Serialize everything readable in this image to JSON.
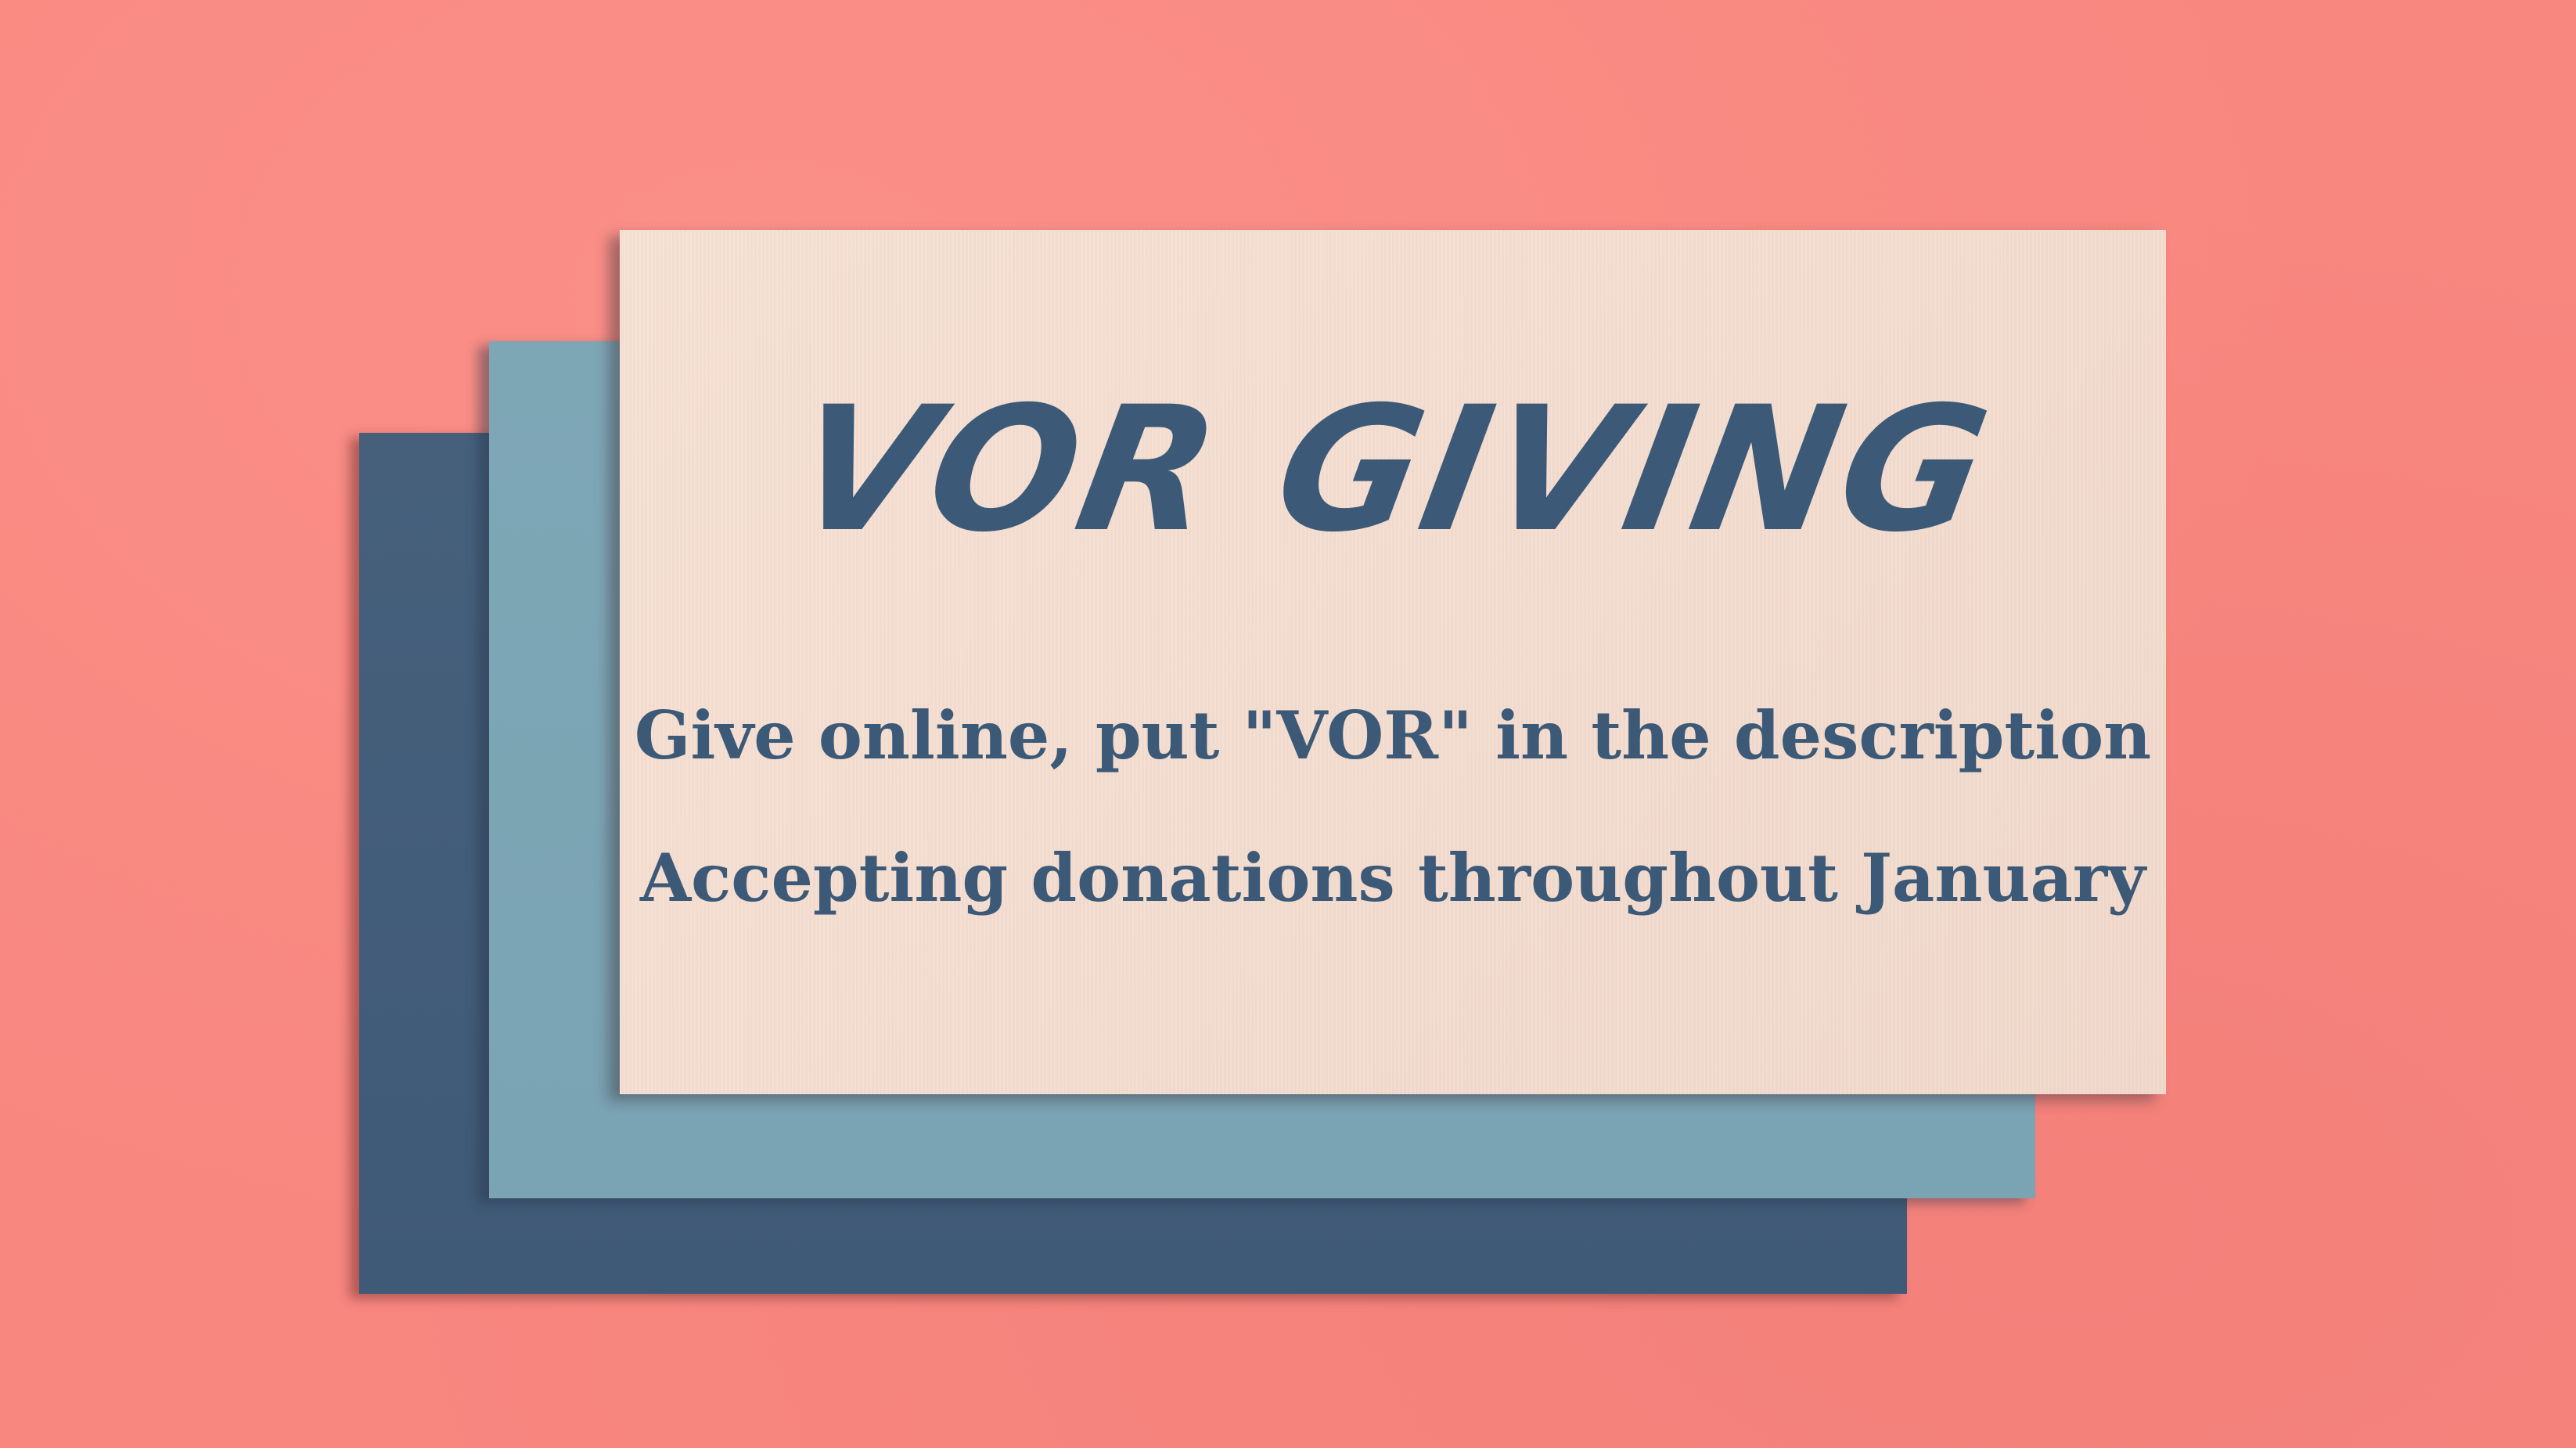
{
  "title": "VOR GIVING",
  "lines": [
    "Give online, put \"VOR\" in the description",
    "Accepting donations throughout January"
  ],
  "colors": {
    "background": "#f88780",
    "sheet_navy": "#43607c",
    "sheet_blue": "#7ea7b6",
    "sheet_cream": "#f6dfd2",
    "text": "#3c5a77"
  }
}
